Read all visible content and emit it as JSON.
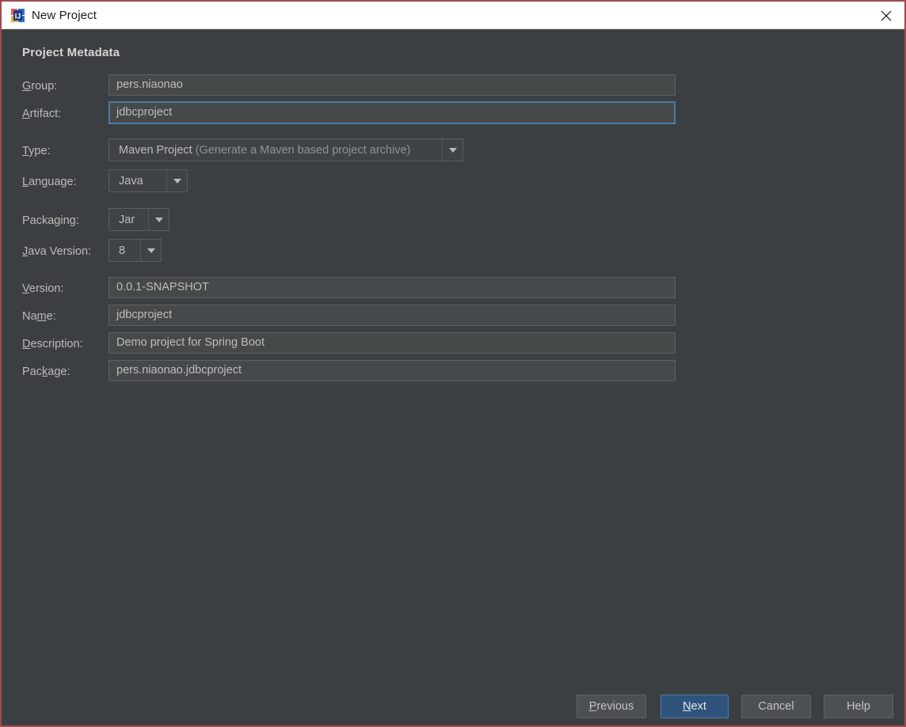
{
  "window": {
    "title": "New Project",
    "icon": "intellij-idea-icon",
    "close_icon": "close-icon",
    "border_color": "#9e4a50",
    "background": "#3c3f41",
    "titlebar_background": "#ffffff"
  },
  "form": {
    "section_title": "Project Metadata",
    "fields": [
      {
        "name": "group",
        "label_pre": "",
        "label_mnemonic": "G",
        "label_post": "roup:",
        "value": "pers.niaonao",
        "control": "text",
        "focused": false
      },
      {
        "name": "artifact",
        "label_pre": "",
        "label_mnemonic": "A",
        "label_post": "rtifact:",
        "value": "jdbcproject",
        "control": "text",
        "focused": true
      },
      {
        "name": "type",
        "label_pre": "",
        "label_mnemonic": "T",
        "label_post": "ype:",
        "value": "Maven Project",
        "value_hint": "(Generate a Maven based project archive)",
        "control": "combo"
      },
      {
        "name": "language",
        "label_pre": "",
        "label_mnemonic": "L",
        "label_post": "anguage:",
        "value": "Java",
        "control": "combo"
      },
      {
        "name": "packaging",
        "label_pre": "Packaging:",
        "label_mnemonic": "",
        "label_post": "",
        "value": "Jar",
        "control": "combo"
      },
      {
        "name": "java-version",
        "label_pre": "",
        "label_mnemonic": "J",
        "label_post": "ava Version:",
        "value": "8",
        "control": "combo"
      },
      {
        "name": "version",
        "label_pre": "",
        "label_mnemonic": "V",
        "label_post": "ersion:",
        "value": "0.0.1-SNAPSHOT",
        "control": "text",
        "focused": false
      },
      {
        "name": "project-name",
        "label_pre": "Na",
        "label_mnemonic": "m",
        "label_post": "e:",
        "value": "jdbcproject",
        "control": "text",
        "focused": false
      },
      {
        "name": "description",
        "label_pre": "",
        "label_mnemonic": "D",
        "label_post": "escription:",
        "value": "Demo project for Spring Boot",
        "control": "text",
        "focused": false
      },
      {
        "name": "package",
        "label_pre": "Pac",
        "label_mnemonic": "k",
        "label_post": "age:",
        "value": "pers.niaonao.jdbcproject",
        "control": "text",
        "focused": false
      }
    ]
  },
  "buttons": {
    "previous": {
      "pre": "",
      "mnemonic": "P",
      "post": "revious"
    },
    "next": {
      "pre": "",
      "mnemonic": "N",
      "post": "ext",
      "default": true
    },
    "cancel": {
      "pre": "Cancel",
      "mnemonic": "",
      "post": ""
    },
    "help": {
      "pre": "Help",
      "mnemonic": "",
      "post": ""
    }
  },
  "colors": {
    "accent_focus": "#4a7aa7",
    "default_button": "#2f537a",
    "text": "#bdbdbd",
    "label": "#bbbbbb"
  }
}
